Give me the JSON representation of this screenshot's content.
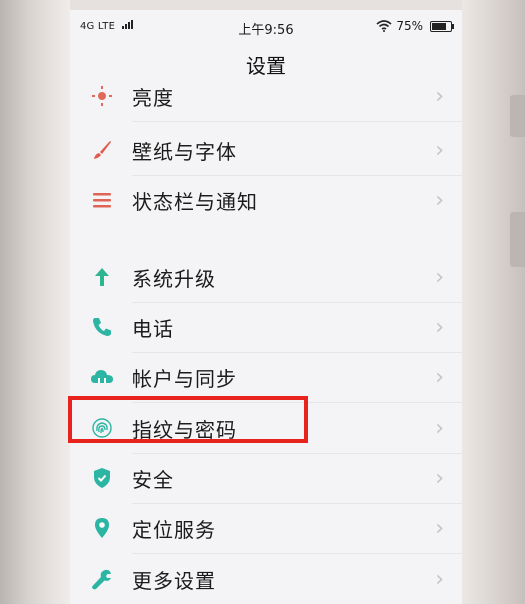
{
  "status_bar": {
    "network": "4G LTE",
    "time": "上午9:56",
    "battery_percent": "75%",
    "battery_level": 0.75
  },
  "header": {
    "title": "设置"
  },
  "settings_items": [
    {
      "label": "亮度",
      "icon": "brightness-icon",
      "color": "#e06a5a"
    },
    {
      "label": "壁纸与字体",
      "icon": "paintbrush-icon",
      "color": "#e05a4e"
    },
    {
      "label": "状态栏与通知",
      "icon": "list-icon",
      "color": "#e06456"
    },
    {
      "label": "系统升级",
      "icon": "arrow-up-icon",
      "color": "#2db58f"
    },
    {
      "label": "电话",
      "icon": "phone-icon",
      "color": "#2db5a4"
    },
    {
      "label": "帐户与同步",
      "icon": "cloud-icon",
      "color": "#2db5a4"
    },
    {
      "label": "指纹与密码",
      "icon": "fingerprint-icon",
      "color": "#2db5a4"
    },
    {
      "label": "安全",
      "icon": "shield-icon",
      "color": "#2db5a4"
    },
    {
      "label": "定位服务",
      "icon": "location-pin-icon",
      "color": "#2db5a4"
    },
    {
      "label": "更多设置",
      "icon": "wrench-icon",
      "color": "#2db5a4"
    }
  ],
  "highlight_color": "#e8221c"
}
